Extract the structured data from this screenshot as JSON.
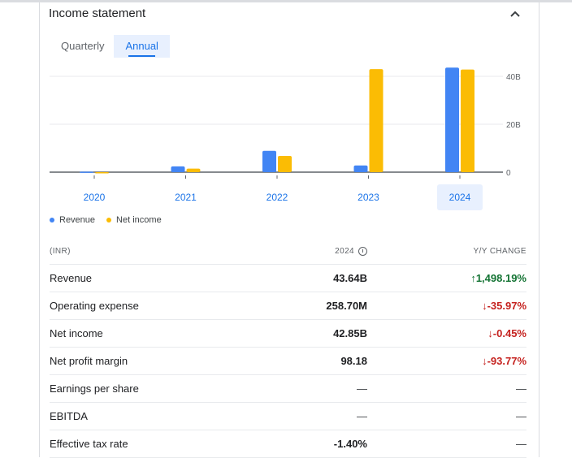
{
  "card": {
    "title": "Income statement"
  },
  "tabs": [
    {
      "label": "Quarterly"
    },
    {
      "label": "Annual"
    }
  ],
  "colors": {
    "revenue": "#4285f4",
    "net_income": "#fbbc04",
    "accent": "#1a73e8",
    "positive": "#137333",
    "negative": "#c5221f"
  },
  "icons": {
    "collapse": "chevron-up-icon",
    "info": "info-icon",
    "arrow_up": "arrow-up-icon",
    "arrow_down": "arrow-down-icon"
  },
  "chart_data": {
    "type": "bar",
    "categories": [
      "2020",
      "2021",
      "2022",
      "2023",
      "2024"
    ],
    "selected_category": "2024",
    "series": [
      {
        "name": "Revenue",
        "values": [
          0.2,
          2.4,
          8.9,
          2.8,
          43.64
        ]
      },
      {
        "name": "Net income",
        "values": [
          -0.1,
          1.5,
          6.8,
          43.0,
          42.85
        ]
      }
    ],
    "y_ticks": [
      "0",
      "20B",
      "40B"
    ],
    "ylim": [
      0,
      40
    ],
    "grid": true,
    "legend_position": "bottom-left"
  },
  "legend": {
    "revenue": "Revenue",
    "net_income": "Net income"
  },
  "table": {
    "header": {
      "label": "(INR)",
      "period": "2024",
      "change": "Y/Y CHANGE"
    },
    "rows": [
      {
        "label": "Revenue",
        "value": "43.64B",
        "change": "1,498.19%",
        "direction": "up"
      },
      {
        "label": "Operating expense",
        "value": "258.70M",
        "change": "-35.97%",
        "direction": "down"
      },
      {
        "label": "Net income",
        "value": "42.85B",
        "change": "-0.45%",
        "direction": "down"
      },
      {
        "label": "Net profit margin",
        "value": "98.18",
        "change": "-93.77%",
        "direction": "down"
      },
      {
        "label": "Earnings per share",
        "value": "—",
        "change": "—",
        "direction": "none"
      },
      {
        "label": "EBITDA",
        "value": "—",
        "change": "—",
        "direction": "none"
      },
      {
        "label": "Effective tax rate",
        "value": "-1.40%",
        "change": "—",
        "direction": "none"
      }
    ]
  }
}
